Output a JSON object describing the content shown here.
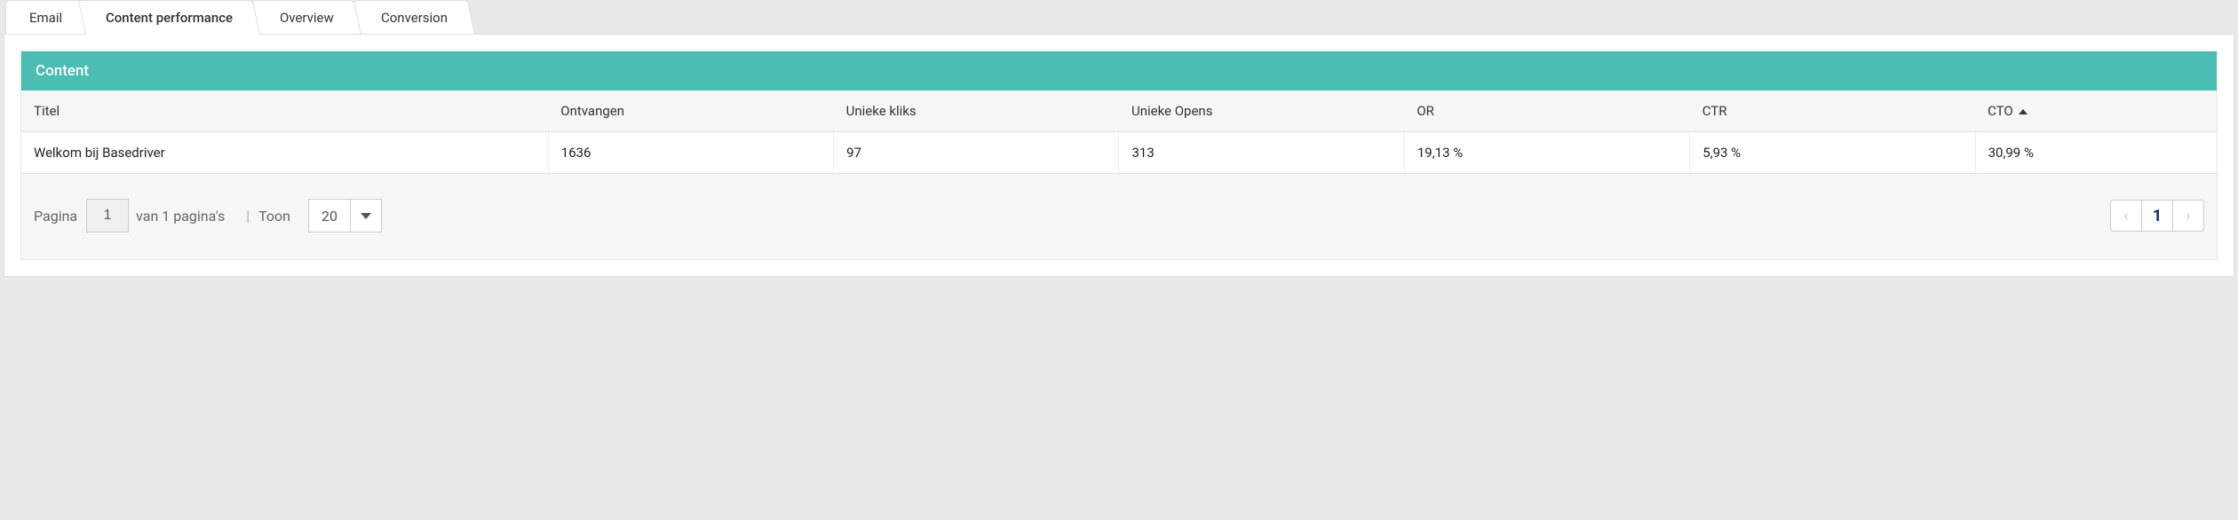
{
  "tabs": [
    {
      "label": "Email",
      "active": false
    },
    {
      "label": "Content performance",
      "active": true
    },
    {
      "label": "Overview",
      "active": false
    },
    {
      "label": "Conversion",
      "active": false
    }
  ],
  "card": {
    "title": "Content"
  },
  "table": {
    "headers": {
      "titel": "Titel",
      "ontvangen": "Ontvangen",
      "ukliks": "Unieke kliks",
      "uopens": "Unieke Opens",
      "or": "OR",
      "ctr": "CTR",
      "cto": "CTO"
    },
    "rows": [
      {
        "titel": "Welkom bij Basedriver",
        "ontvangen": "1636",
        "ukliks": "97",
        "uopens": "313",
        "or": "19,13 %",
        "ctr": "5,93 %",
        "cto": "30,99 %"
      }
    ]
  },
  "pager": {
    "page_label": "Pagina",
    "page_value": "1",
    "of_pages": "van 1 pagina's",
    "show_label": "Toon",
    "page_size": "20",
    "prev": "‹",
    "current": "1",
    "next": "›"
  }
}
